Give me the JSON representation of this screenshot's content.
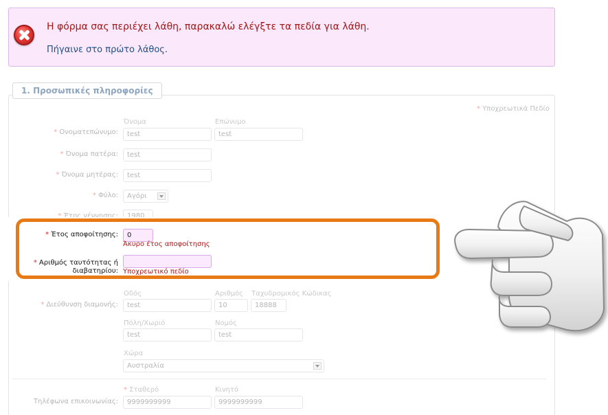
{
  "error": {
    "message": "Η φόρμα σας περιέχει λάθη, παρακαλώ ελέγξτε τα πεδία για λάθη.",
    "link": "Πήγαινε στο πρώτο λάθος."
  },
  "section": {
    "legend": "1. Προσωπικές πληροφορίες",
    "required_note": "Υποχρεωτικά Πεδίο"
  },
  "fields": {
    "fullname": {
      "label": "Ονοματεπώνυμο:",
      "first_caption": "Όνομα",
      "first_value": "test",
      "last_caption": "Επώνυμο",
      "last_value": "test"
    },
    "father": {
      "label": "Όνομα πατέρα:",
      "value": "test"
    },
    "mother": {
      "label": "Όνομα μητέρας:",
      "value": "test"
    },
    "gender": {
      "label": "Φύλο:",
      "value": "Αγόρι"
    },
    "birth_year": {
      "label": "Έτος γέννησης:",
      "value": "1980"
    },
    "grad_year": {
      "label": "Έτος αποφοίτησης:",
      "value": "0",
      "error": "Άκυρο έτος αποφοίτησης"
    },
    "id_number": {
      "label_line1": "Αριθμός ταυτότητας ή",
      "label_line2": "διαβατηρίου:",
      "value": "",
      "error": "Υποχρεωτικό πεδίο"
    },
    "address": {
      "label": "Διεύθυνση διαμονής:",
      "street_caption": "Οδός",
      "street_value": "test",
      "number_caption": "Αριθμός",
      "number_value": "10",
      "postal_caption": "Ταχυδρομικός Κώδικας",
      "postal_value": "18888",
      "city_caption": "Πόλη/Χωριό",
      "city_value": "test",
      "prefecture_caption": "Νομός",
      "prefecture_value": "test",
      "country_caption": "Χώρα",
      "country_value": "Αυστραλία"
    },
    "phones": {
      "label": "Τηλέφωνα επικοινωνίας:",
      "landline_caption": "Σταθερό",
      "landline_value": "9999999999",
      "mobile_caption": "Κινητό",
      "mobile_value": "9999999999"
    }
  },
  "icons": {
    "error": "error-x-icon",
    "hand": "pointing-hand-icon"
  }
}
